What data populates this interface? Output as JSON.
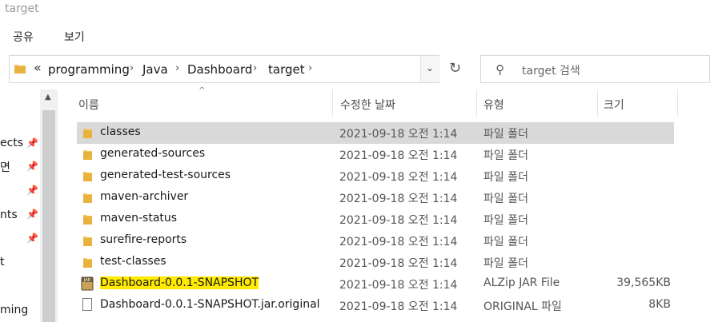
{
  "window": {
    "title": "target"
  },
  "ribbon": {
    "tabs": [
      "공유",
      "보기"
    ]
  },
  "address": {
    "overflow": "«",
    "crumbs": [
      "programming",
      "Java",
      "Dashboard",
      "target"
    ],
    "separator": "›",
    "dropdown": "⌄",
    "refresh": "↻"
  },
  "search": {
    "placeholder": "target 검색",
    "icon": "search-icon"
  },
  "nav": {
    "items": [
      {
        "label": "ects",
        "pinned": true
      },
      {
        "label": "면",
        "pinned": true
      },
      {
        "label": "",
        "pinned": true
      },
      {
        "label": "nts",
        "pinned": true
      },
      {
        "label": "",
        "pinned": true
      },
      {
        "label": "t",
        "pinned": false
      },
      {
        "label": "",
        "pinned": false
      },
      {
        "label": "ming",
        "pinned": false
      }
    ]
  },
  "columns": {
    "name": "이름",
    "date": "수정한 날짜",
    "type": "유형",
    "size": "크기"
  },
  "files": [
    {
      "name": "classes",
      "date": "2021-09-18 오전 1:14",
      "type": "파일 폴더",
      "size": "",
      "icon": "folder-icon",
      "selected": true
    },
    {
      "name": "generated-sources",
      "date": "2021-09-18 오전 1:14",
      "type": "파일 폴더",
      "size": "",
      "icon": "folder-icon"
    },
    {
      "name": "generated-test-sources",
      "date": "2021-09-18 오전 1:14",
      "type": "파일 폴더",
      "size": "",
      "icon": "folder-icon"
    },
    {
      "name": "maven-archiver",
      "date": "2021-09-18 오전 1:14",
      "type": "파일 폴더",
      "size": "",
      "icon": "folder-icon"
    },
    {
      "name": "maven-status",
      "date": "2021-09-18 오전 1:14",
      "type": "파일 폴더",
      "size": "",
      "icon": "folder-icon"
    },
    {
      "name": "surefire-reports",
      "date": "2021-09-18 오전 1:14",
      "type": "파일 폴더",
      "size": "",
      "icon": "folder-icon"
    },
    {
      "name": "test-classes",
      "date": "2021-09-18 오전 1:14",
      "type": "파일 폴더",
      "size": "",
      "icon": "folder-icon"
    },
    {
      "name": "Dashboard-0.0.1-SNAPSHOT",
      "date": "2021-09-18 오전 1:14",
      "type": "ALZip JAR File",
      "size": "39,565KB",
      "icon": "jar-file-icon",
      "highlighted": true
    },
    {
      "name": "Dashboard-0.0.1-SNAPSHOT.jar.original",
      "date": "2021-09-18 오전 1:14",
      "type": "ORIGINAL 파일",
      "size": "8KB",
      "icon": "file-icon"
    }
  ],
  "colors": {
    "selection": "#d9d9d9",
    "highlight": "#ffea00",
    "folder": "#f2c55c"
  }
}
